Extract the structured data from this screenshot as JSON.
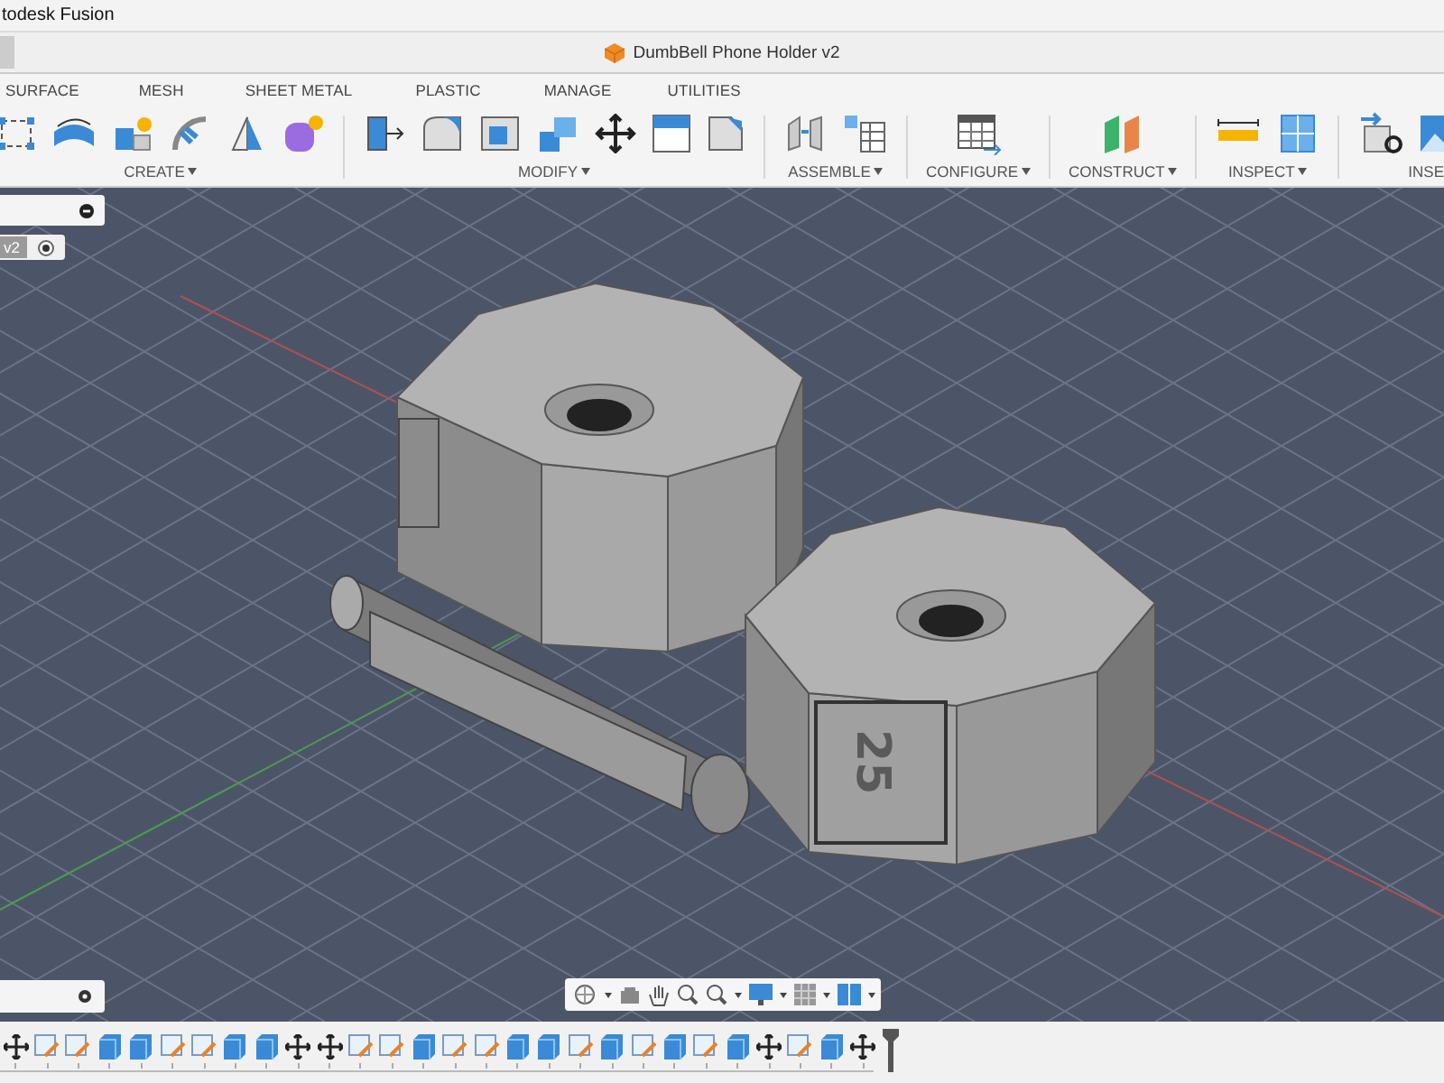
{
  "app_title": "todesk Fusion",
  "document": {
    "title": "DumbBell Phone Holder v2"
  },
  "ribbon_tabs": [
    "SURFACE",
    "MESH",
    "SHEET METAL",
    "PLASTIC",
    "MANAGE",
    "UTILITIES"
  ],
  "groups": [
    {
      "label": "CREATE",
      "kind": "create"
    },
    {
      "label": "MODIFY",
      "kind": "modify"
    },
    {
      "label": "ASSEMBLE",
      "kind": "assemble"
    },
    {
      "label": "CONFIGURE",
      "kind": "configure"
    },
    {
      "label": "CONSTRUCT",
      "kind": "construct"
    },
    {
      "label": "INSPECT",
      "kind": "inspect"
    },
    {
      "label": "INSE",
      "kind": "insert"
    }
  ],
  "browser": {
    "version": "v2"
  },
  "model": {
    "label": "25"
  },
  "timeline": [
    {
      "kind": "move"
    },
    {
      "kind": "sketch"
    },
    {
      "kind": "sketch"
    },
    {
      "kind": "body"
    },
    {
      "kind": "body"
    },
    {
      "kind": "sketch"
    },
    {
      "kind": "sketch"
    },
    {
      "kind": "body"
    },
    {
      "kind": "body"
    },
    {
      "kind": "move"
    },
    {
      "kind": "move"
    },
    {
      "kind": "sketch"
    },
    {
      "kind": "sketch"
    },
    {
      "kind": "body"
    },
    {
      "kind": "sketch"
    },
    {
      "kind": "sketch"
    },
    {
      "kind": "body"
    },
    {
      "kind": "body"
    },
    {
      "kind": "sketch"
    },
    {
      "kind": "body"
    },
    {
      "kind": "sketch"
    },
    {
      "kind": "body"
    },
    {
      "kind": "sketch"
    },
    {
      "kind": "body"
    },
    {
      "kind": "move"
    },
    {
      "kind": "sketch"
    },
    {
      "kind": "body"
    },
    {
      "kind": "move"
    }
  ]
}
